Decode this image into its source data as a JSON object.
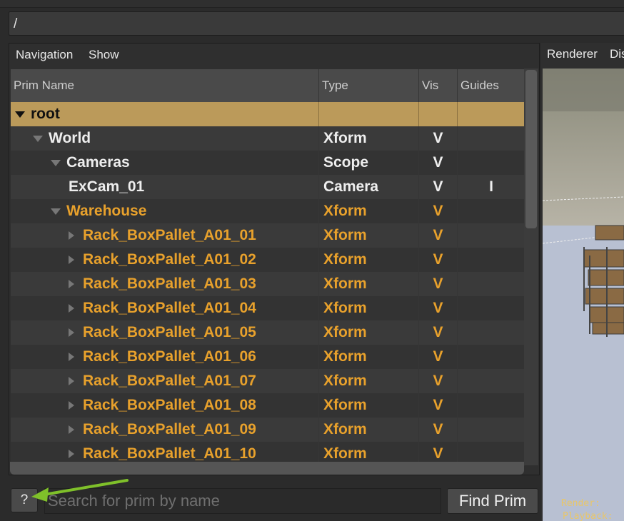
{
  "path": "/",
  "left_menu": {
    "navigation": "Navigation",
    "show": "Show"
  },
  "columns": {
    "prim_name": "Prim Name",
    "type": "Type",
    "vis": "Vis",
    "guides": "Guides"
  },
  "rows": [
    {
      "name": "root",
      "type": "",
      "vis": "",
      "guides": "",
      "expander": "expanded",
      "depth": 0,
      "color": "selected"
    },
    {
      "name": "World",
      "type": "Xform",
      "vis": "V",
      "guides": "",
      "expander": "expanded",
      "depth": 1,
      "color": "white"
    },
    {
      "name": "Cameras",
      "type": "Scope",
      "vis": "V",
      "guides": "",
      "expander": "expanded",
      "depth": 2,
      "color": "white"
    },
    {
      "name": "ExCam_01",
      "type": "Camera",
      "vis": "V",
      "guides": "I",
      "expander": "none",
      "depth": 3,
      "color": "white"
    },
    {
      "name": "Warehouse",
      "type": "Xform",
      "vis": "V",
      "guides": "",
      "expander": "expanded",
      "depth": 2,
      "color": "orange"
    },
    {
      "name": "Rack_BoxPallet_A01_01",
      "type": "Xform",
      "vis": "V",
      "guides": "",
      "expander": "collapsed",
      "depth": 3,
      "color": "orange"
    },
    {
      "name": "Rack_BoxPallet_A01_02",
      "type": "Xform",
      "vis": "V",
      "guides": "",
      "expander": "collapsed",
      "depth": 3,
      "color": "orange"
    },
    {
      "name": "Rack_BoxPallet_A01_03",
      "type": "Xform",
      "vis": "V",
      "guides": "",
      "expander": "collapsed",
      "depth": 3,
      "color": "orange"
    },
    {
      "name": "Rack_BoxPallet_A01_04",
      "type": "Xform",
      "vis": "V",
      "guides": "",
      "expander": "collapsed",
      "depth": 3,
      "color": "orange"
    },
    {
      "name": "Rack_BoxPallet_A01_05",
      "type": "Xform",
      "vis": "V",
      "guides": "",
      "expander": "collapsed",
      "depth": 3,
      "color": "orange"
    },
    {
      "name": "Rack_BoxPallet_A01_06",
      "type": "Xform",
      "vis": "V",
      "guides": "",
      "expander": "collapsed",
      "depth": 3,
      "color": "orange"
    },
    {
      "name": "Rack_BoxPallet_A01_07",
      "type": "Xform",
      "vis": "V",
      "guides": "",
      "expander": "collapsed",
      "depth": 3,
      "color": "orange"
    },
    {
      "name": "Rack_BoxPallet_A01_08",
      "type": "Xform",
      "vis": "V",
      "guides": "",
      "expander": "collapsed",
      "depth": 3,
      "color": "orange"
    },
    {
      "name": "Rack_BoxPallet_A01_09",
      "type": "Xform",
      "vis": "V",
      "guides": "",
      "expander": "collapsed",
      "depth": 3,
      "color": "orange"
    },
    {
      "name": "Rack_BoxPallet_A01_10",
      "type": "Xform",
      "vis": "V",
      "guides": "",
      "expander": "collapsed",
      "depth": 3,
      "color": "orange"
    }
  ],
  "search": {
    "placeholder": "Search for prim by name",
    "value": "",
    "help_label": "?",
    "find_label": "Find Prim"
  },
  "right_menu": {
    "renderer": "Renderer",
    "display": "Dis"
  },
  "hud": {
    "render": "Render:",
    "playback": "Playback:"
  },
  "colors": {
    "selected_row": "#bb9a5a",
    "orange_text": "#e8a12c",
    "arrow": "#7fc02a"
  }
}
